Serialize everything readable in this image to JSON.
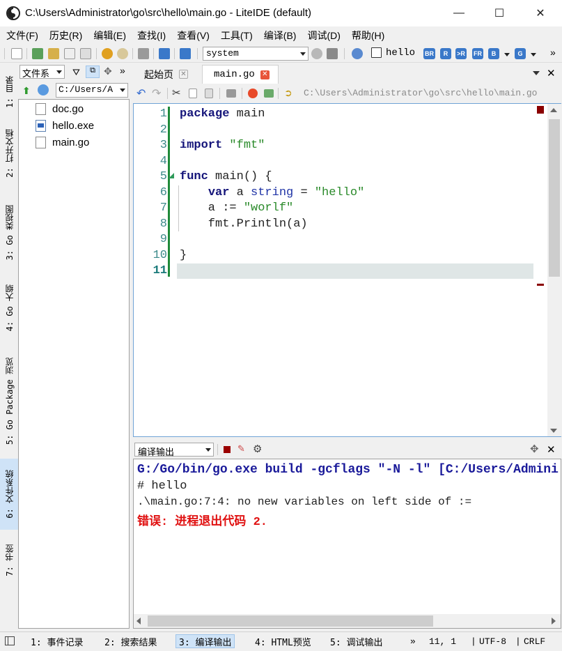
{
  "window": {
    "title": "C:\\Users\\Administrator\\go\\src\\hello\\main.go - LiteIDE (default)",
    "minimize": "—",
    "maximize": "☐",
    "close": "✕"
  },
  "menu": [
    "文件(F)",
    "历史(R)",
    "编辑(E)",
    "查找(I)",
    "查看(V)",
    "工具(T)",
    "编译(B)",
    "调试(D)",
    "帮助(H)"
  ],
  "toolbar": {
    "env_select": "system",
    "build_target": "hello",
    "build_buttons": [
      "BR",
      "R",
      ">R",
      "FR",
      "B",
      "G"
    ],
    "overflow": "»"
  },
  "left_tabs": [
    "1: 目录",
    "2: 打开文档",
    "3: Go 类视图",
    "4: Go 大纲",
    "5: Go Package 浏览",
    "6: 文件系统",
    "7: 书签"
  ],
  "file_panel": {
    "view_select": "文件系",
    "path_select": "C:/Users/A",
    "overflow": "»",
    "files": [
      {
        "name": "doc.go",
        "icon": "go-file-icon"
      },
      {
        "name": "hello.exe",
        "icon": "exe-file-icon"
      },
      {
        "name": "main.go",
        "icon": "go-file-icon"
      }
    ]
  },
  "editor": {
    "tabs": [
      {
        "label": "起始页",
        "close": "✕"
      },
      {
        "label": "main.go",
        "close": "✕"
      }
    ],
    "path": "C:\\Users\\Administrator\\go\\src\\hello\\main.go",
    "line_numbers": [
      "1",
      "2",
      "3",
      "4",
      "5",
      "6",
      "7",
      "8",
      "9",
      "10",
      "11"
    ],
    "code": {
      "l1_kw": "package",
      "l1_rest": " main",
      "l3_kw": "import",
      "l3_str": " \"fmt\"",
      "l5_kw": "func",
      "l5_rest": " main() {",
      "l6_indent": "    ",
      "l6_kw": "var",
      "l6_a": " a ",
      "l6_type": "string",
      "l6_eq": " = ",
      "l6_str": "\"hello\"",
      "l7_pre": "    a := ",
      "l7_str": "\"worlf\"",
      "l8": "    fmt.Println(a)",
      "l10": "}"
    }
  },
  "output": {
    "select": "编译输出",
    "lines": {
      "cmd": "G:/Go/bin/go.exe build -gcflags \"-N -l\" [C:/Users/Admini",
      "pkg": "# hello",
      "err": ".\\main.go:7:4: no new variables on left side of :=",
      "exit": "错误: 进程退出代码 2."
    },
    "colors": {
      "cmd": "#1a1a9a",
      "exit": "#e01010"
    }
  },
  "status": {
    "tabs": [
      "1: 事件记录",
      "2: 搜索结果",
      "3: 编译输出",
      "4: HTML预览",
      "5: 调试输出"
    ],
    "overflow": "»",
    "position": "11,  1",
    "encoding": "UTF-8",
    "eol": "CRLF",
    "sep": "|"
  }
}
